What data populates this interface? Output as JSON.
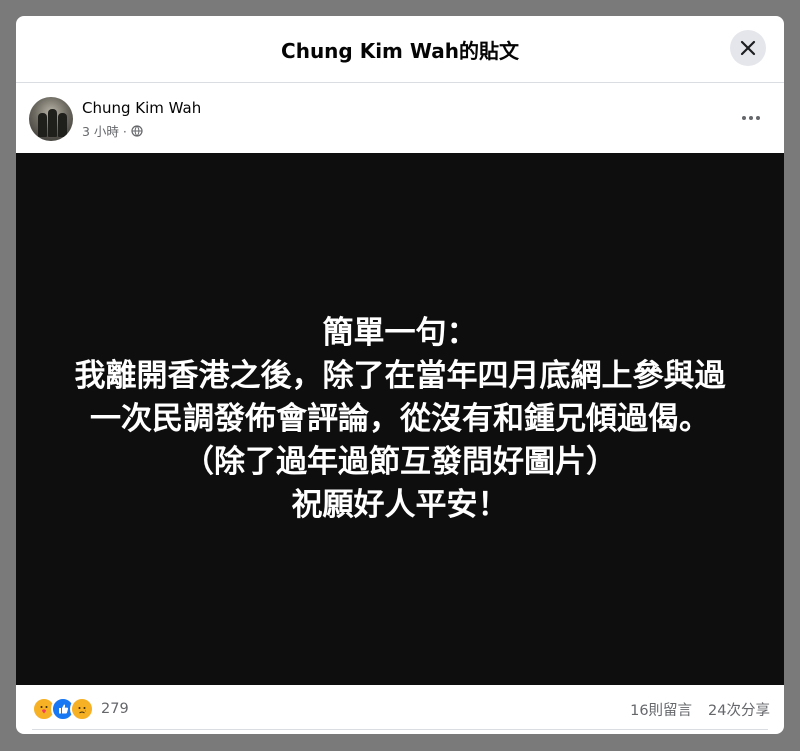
{
  "dialog": {
    "title": "Chung Kim Wah的貼文",
    "close_icon": "close-icon"
  },
  "post": {
    "author": "Chung Kim Wah",
    "time": "3 小時 ·",
    "privacy_icon": "globe-icon",
    "more_icon": "more-horizontal-icon"
  },
  "media": {
    "background": "#0e0e0e",
    "lines": [
      "簡單一句：",
      "我離開香港之後，除了在當年四月底網上參與過",
      "一次民調發佈會評論，從沒有和鍾兄傾過偈。",
      "（除了過年過節互發問好圖片）",
      "祝願好人平安！"
    ]
  },
  "footer": {
    "reaction_icons": [
      "care-reaction-icon",
      "like-reaction-icon",
      "sad-reaction-icon"
    ],
    "reaction_count": "279",
    "comments": "16則留言",
    "shares": "24次分享"
  },
  "colors": {
    "accent": "#1877f2",
    "secondary_text": "#65676b",
    "overlay": "#7a7a7a"
  }
}
